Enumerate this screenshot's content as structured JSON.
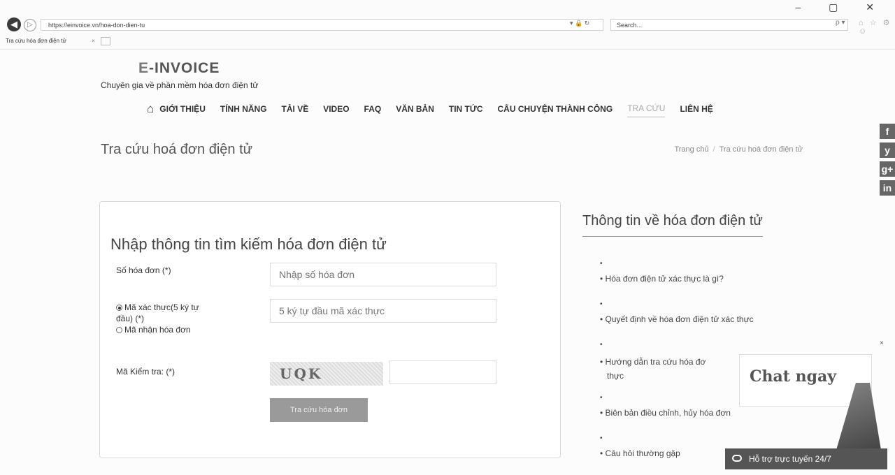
{
  "browser": {
    "window_controls": "– ▢ ✕",
    "back_glyph": "◀",
    "forward_glyph": "▷",
    "url": "https://einvoice.vn/hoa-don-dien-tu",
    "address_icons": "▾ 🔒 ↻",
    "search_placeholder": "Search...",
    "search_icons": "ρ ▾",
    "tool_icons": "⌂ ☆ ⚙ ☺",
    "tab_title": "Tra cứu hóa đơn điện tử",
    "tab_close": "×"
  },
  "site": {
    "logo_mark": "E",
    "logo_text": "-INVOICE",
    "tagline": "Chuyên gia về phần mềm hóa đơn điện tử",
    "menu": [
      "GIỚI THIỆU",
      "TÍNH NĂNG",
      "TẢI VỀ",
      "VIDEO",
      "FAQ",
      "VĂN BẢN",
      "TIN TỨC",
      "CÂU CHUYỆN THÀNH CÔNG",
      "TRA CỨU",
      "LIÊN HỆ"
    ],
    "social": [
      "f",
      "y",
      "g+",
      "in"
    ]
  },
  "page": {
    "title": "Tra cứu hoá đơn điện tử",
    "breadcrumb": [
      "Trang chủ",
      "Tra cứu hoá đơn điện tử"
    ],
    "breadcrumb_sep": "/"
  },
  "form": {
    "title": "Nhập thông tin tìm kiếm hóa đơn điện tử",
    "invoice_label": "Số hóa đơn (*)",
    "invoice_placeholder": "Nhập số hóa đơn",
    "verify_label_1": "Mã xác thực(5 ký tự",
    "verify_label_2": "đầu) (*)",
    "receive_label": "Mã nhận hóa đơn",
    "verify_placeholder": "5 ký tự đầu mã xác thực",
    "captcha_label": "Mã Kiểm tra: (*)",
    "captcha_text": "UQK",
    "captcha_value": "",
    "submit_label": "Tra cứu hóa đơn"
  },
  "sidebar": {
    "title": "Thông tin về hóa đơn điện tử",
    "items": [
      "Hóa đơn điện tử xác thực là gì?",
      "Quyết định về hóa đơn điện tử xác thực",
      "Hướng dẫn tra cứu hóa đơ",
      "thực",
      "Biên bản điều chỉnh, hủy hóa đơn",
      "Câu hỏi thường gặp"
    ],
    "bullet": "•"
  },
  "chat": {
    "close": "×",
    "bubble_text": "Chat ngay",
    "bar_text": "Hỗ trợ trực tuyến 24/7"
  }
}
